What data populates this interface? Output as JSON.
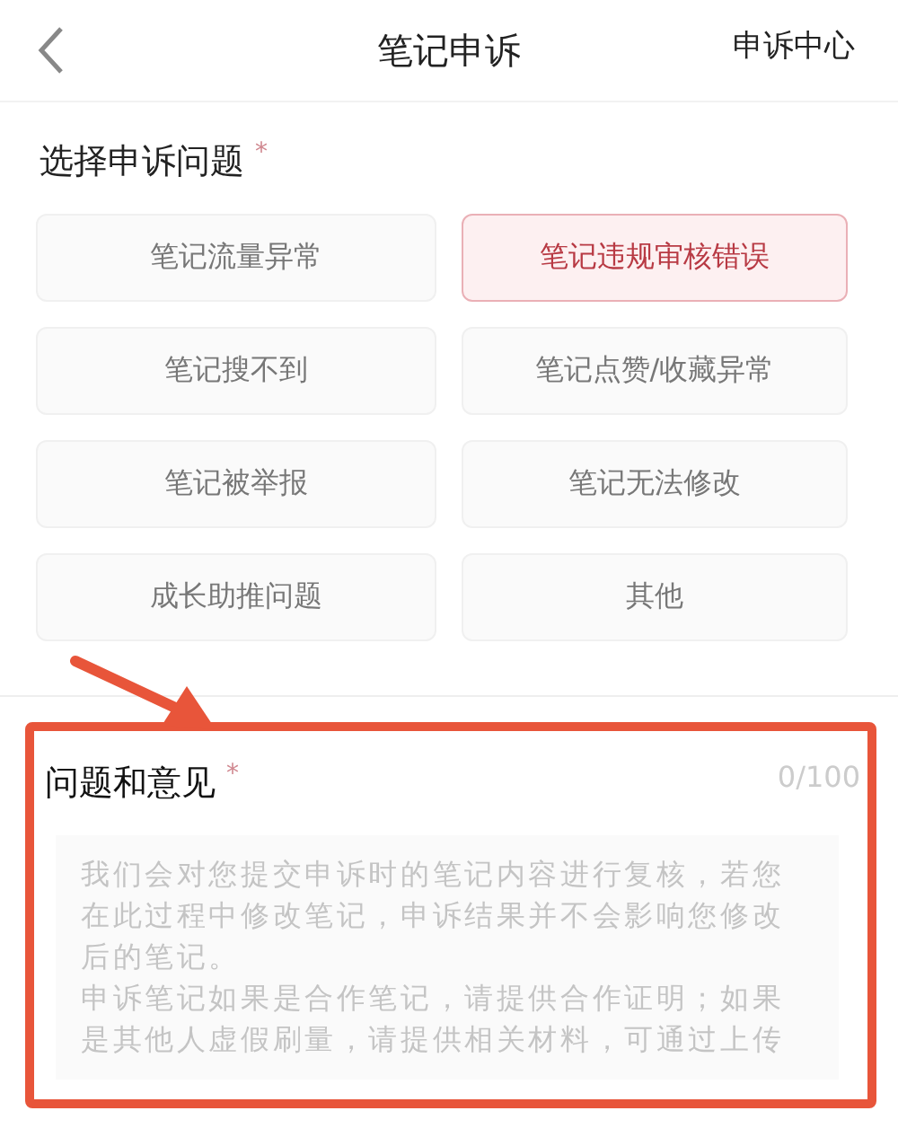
{
  "header": {
    "title": "笔记申诉",
    "action": "申诉中心"
  },
  "issue_section": {
    "title": "选择申诉问题",
    "required_mark": "*",
    "options": [
      {
        "label": "笔记流量异常",
        "selected": false
      },
      {
        "label": "笔记违规审核错误",
        "selected": true
      },
      {
        "label": "笔记搜不到",
        "selected": false
      },
      {
        "label": "笔记点赞/收藏异常",
        "selected": false
      },
      {
        "label": "笔记被举报",
        "selected": false
      },
      {
        "label": "笔记无法修改",
        "selected": false
      },
      {
        "label": "成长助推问题",
        "selected": false
      },
      {
        "label": "其他",
        "selected": false
      }
    ]
  },
  "feedback_section": {
    "title": "问题和意见",
    "required_mark": "*",
    "counter": "0/100",
    "placeholder": [
      "我们会对您提交申诉时的笔记内容进行复核，若您在此过程中修改笔记，申诉结果并不会影响您修改后的笔记。",
      "申诉笔记如果是合作笔记，请提供合作证明；如果是其他人虚假刷量，请提供相关材料，可通过上传"
    ]
  }
}
